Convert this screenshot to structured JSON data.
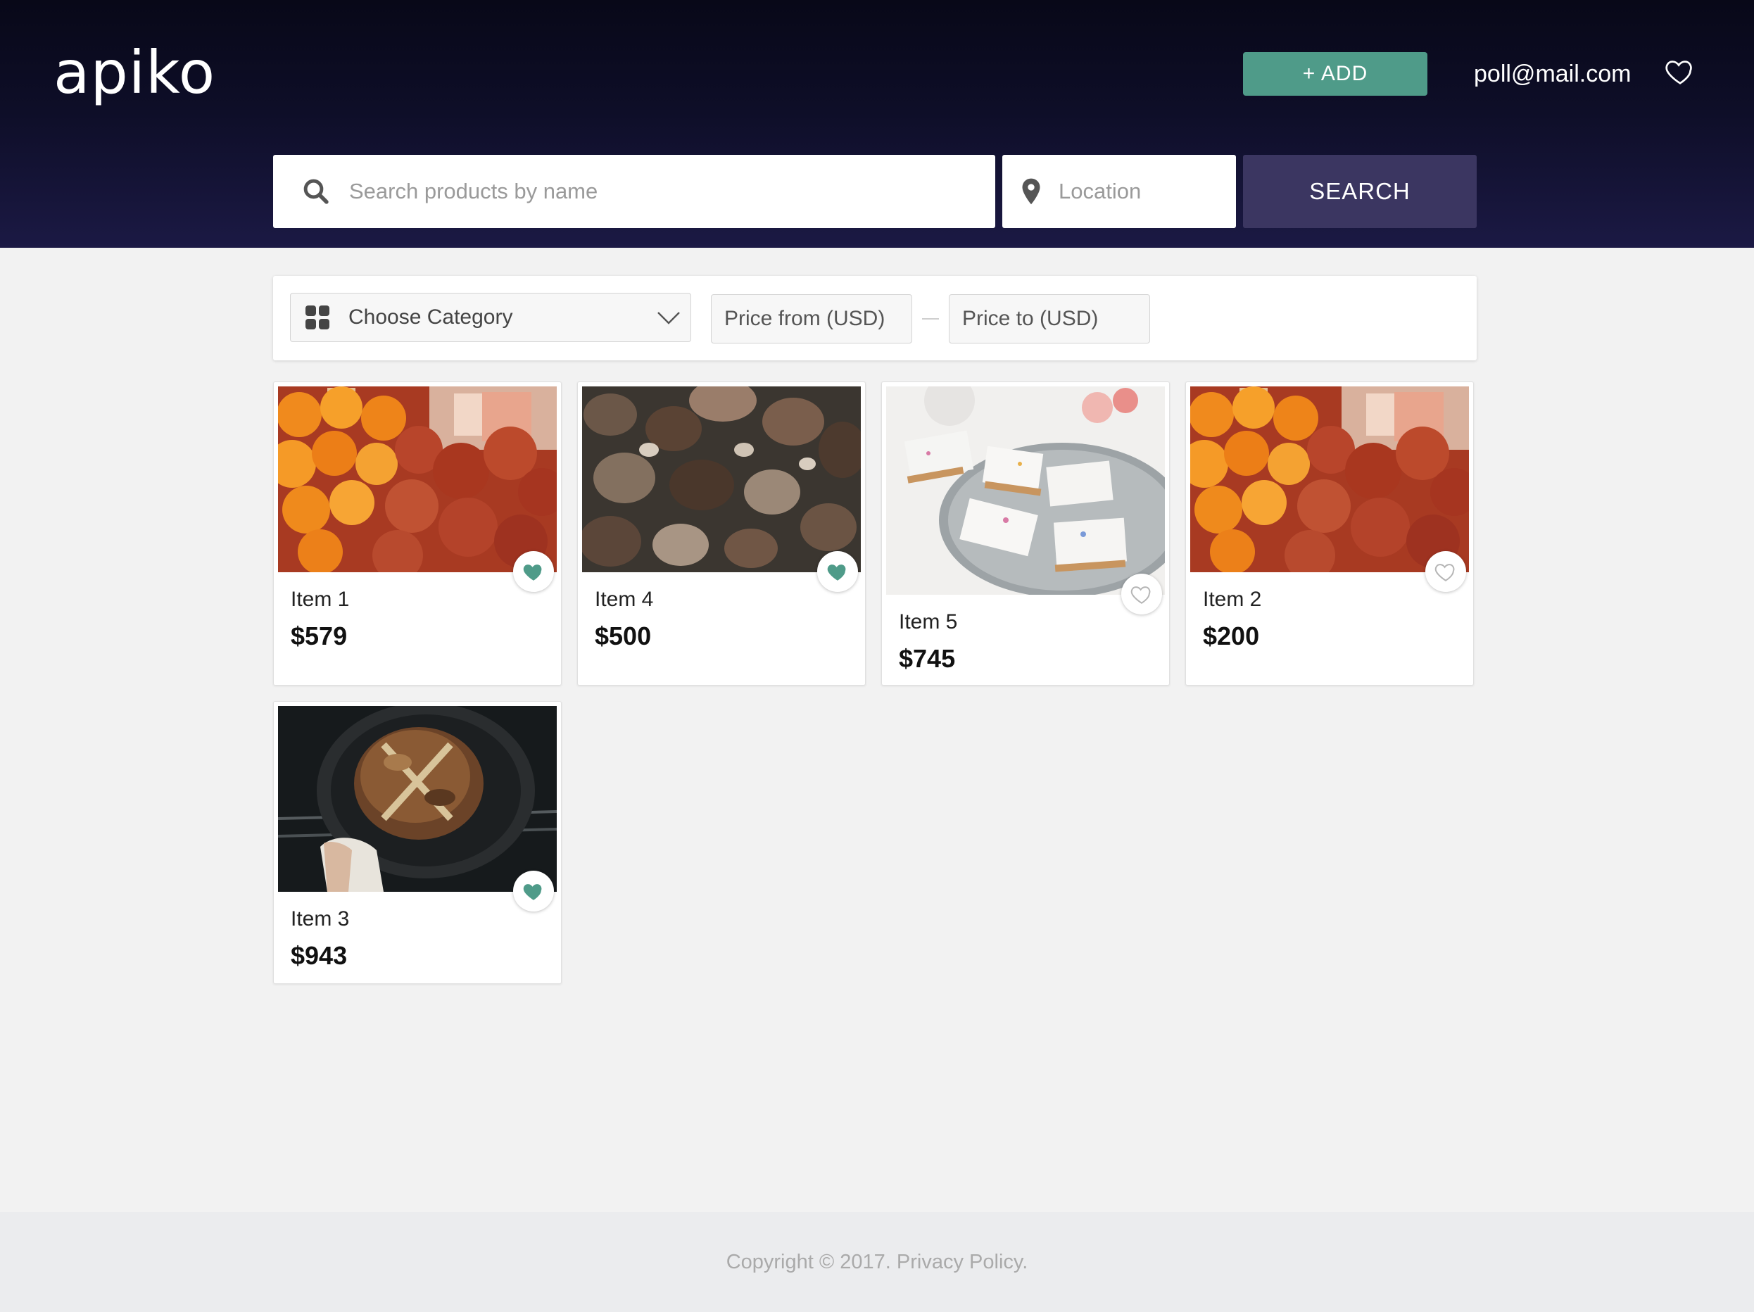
{
  "header": {
    "logo": "apiko",
    "add_button": "+ ADD",
    "user_email": "poll@mail.com",
    "favorites_icon": "heart-outline-icon"
  },
  "search": {
    "placeholder": "Search products by name",
    "location_placeholder": "Location",
    "button": "SEARCH"
  },
  "filters": {
    "category_placeholder": "Choose Category",
    "price_from_placeholder": "Price from (USD)",
    "price_to_placeholder": "Price to (USD)"
  },
  "products": [
    {
      "title": "Item 1",
      "price": "$579",
      "image": "oranges-pomegranates",
      "favorite": true
    },
    {
      "title": "Item 4",
      "price": "$500",
      "image": "mushrooms",
      "favorite": true
    },
    {
      "title": "Item 5",
      "price": "$745",
      "image": "frosted-bars",
      "favorite": false
    },
    {
      "title": "Item 2",
      "price": "$200",
      "image": "oranges-pomegranates",
      "favorite": false
    },
    {
      "title": "Item 3",
      "price": "$943",
      "image": "bread-in-skillet",
      "favorite": true
    }
  ],
  "footer": {
    "text": "Copyright © 2017. Privacy Policy."
  },
  "colors": {
    "accent": "#4f9b89",
    "search_button": "#3b3661",
    "header_dark": "#0e0e28"
  }
}
